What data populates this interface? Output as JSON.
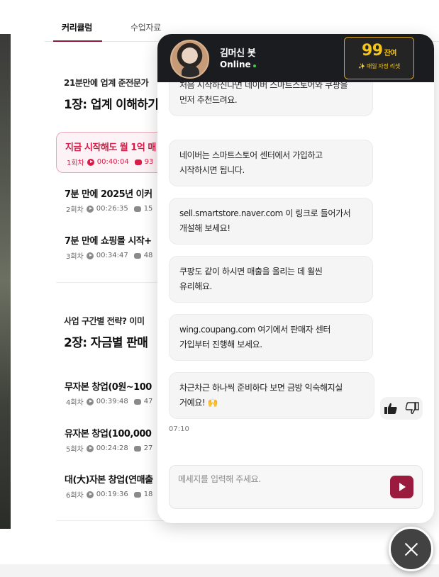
{
  "tabs": {
    "active": "커리큘럼",
    "other": "수업자료"
  },
  "chapters": [
    {
      "subtitle": "21분만에 업계 준전문가",
      "title": "1장: 업계 이해하기",
      "lessons": [
        {
          "title": "지금 시작해도 월 1억 매",
          "episode": "1회차",
          "duration": "00:40:04",
          "comments": "93"
        },
        {
          "title": "7분 만에 2025년 이커",
          "episode": "2회차",
          "duration": "00:26:35",
          "comments": "15"
        },
        {
          "title": "7분 만에 쇼핑몰 시작+",
          "episode": "3회차",
          "duration": "00:34:47",
          "comments": "48"
        }
      ]
    },
    {
      "subtitle": "사업 구간별 전략? 이미",
      "title": "2장: 자금별 판매",
      "lessons": [
        {
          "title": "무자본 창업(0원~100",
          "episode": "4회차",
          "duration": "00:39:48",
          "comments": "47"
        },
        {
          "title": "유자본 창업(100,000",
          "episode": "5회차",
          "duration": "00:24:28",
          "comments": "27"
        },
        {
          "title": "대(大)자본 창업(연매출",
          "episode": "6회차",
          "duration": "00:19:36",
          "comments": "18"
        }
      ]
    }
  ],
  "chat": {
    "bot_name": "김머신 봇",
    "status": "Online",
    "credits": {
      "count": "99",
      "unit": "잔여",
      "label": "✨ 매일 자정 리셋"
    },
    "messages": [
      "처음 시작하신다면 네이버 스마트스토어와 쿠팡을\n먼저 추천드려요.",
      "네이버는 스마트스토어 센터에서 가입하고\n시작하시면 됩니다.",
      "sell.smartstore.naver.com 이 링크로 들어가서\n개설해 보세요!",
      "쿠팡도 같이 하시면 매출을 올리는 데 훨씬\n유리해요.",
      "wing.coupang.com 여기에서 판매자 센터\n가입부터 진행해 보세요.",
      "차근차근 하나씩 준비하다 보면 금방 익숙해지실\n거예요! 🙌"
    ],
    "time": "07:10",
    "input_placeholder": "메세지를 입력해 주세요."
  },
  "colors": {
    "accent": "#9b1b3e",
    "active_lesson": "#d81b48",
    "header_bg": "#1a1c20",
    "credit_gold": "#f5c518"
  }
}
